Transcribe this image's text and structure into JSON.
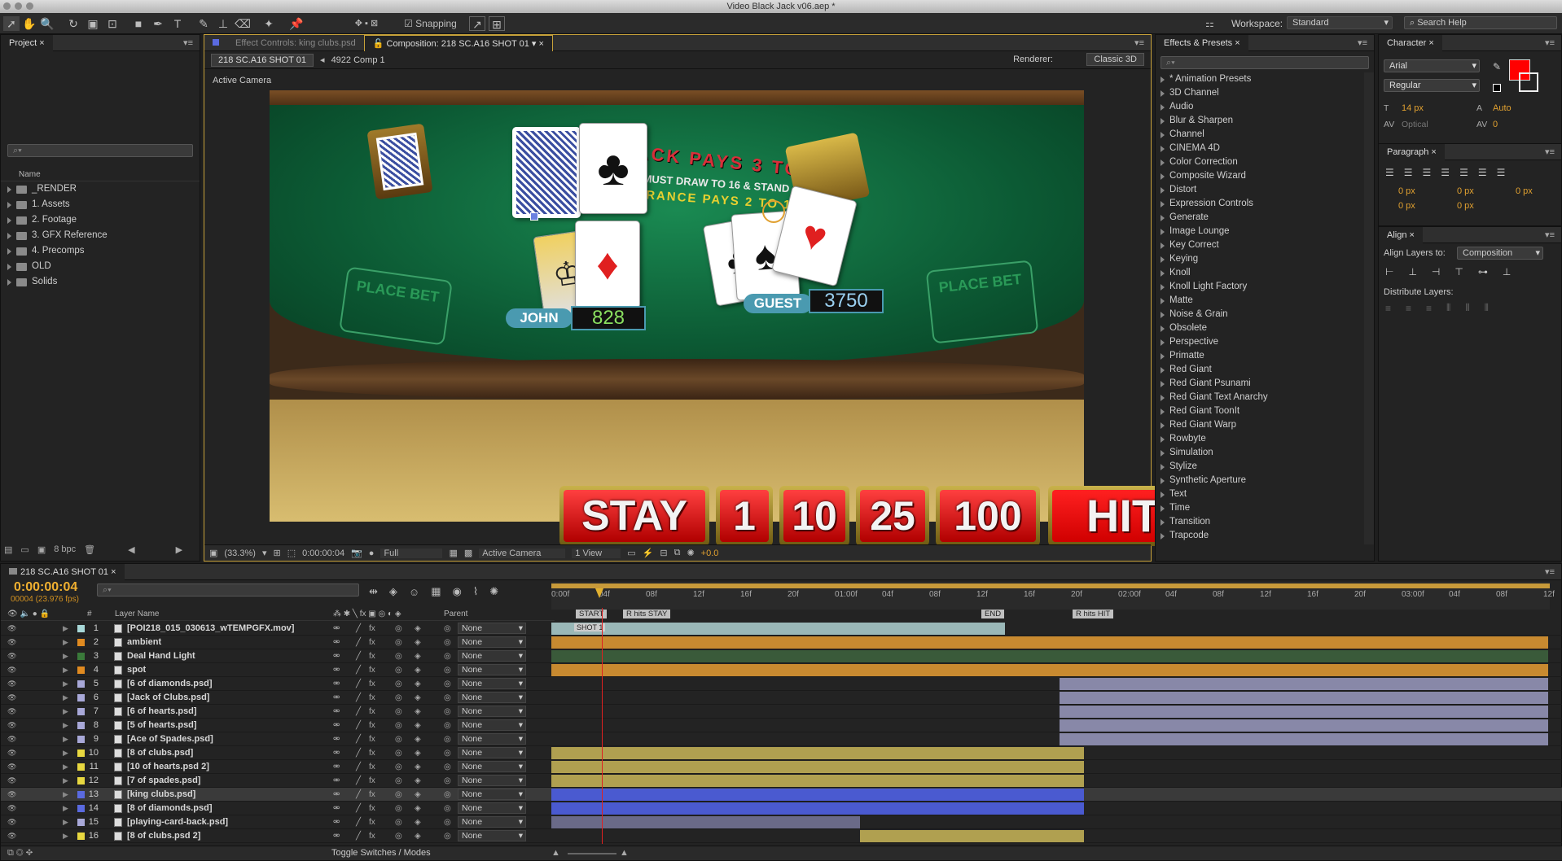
{
  "window": {
    "title": "Video Black Jack v06.aep *"
  },
  "toolbar": {
    "snapping": "Snapping",
    "workspace_label": "Workspace:",
    "workspace": "Standard",
    "search_help": "Search Help"
  },
  "project": {
    "tab": "Project",
    "col_name": "Name",
    "bpc": "8 bpc",
    "items": [
      "_RENDER",
      "1. Assets",
      "2. Footage",
      "3. GFX Reference",
      "4. Precomps",
      "OLD",
      "Solids"
    ]
  },
  "comp_panel": {
    "tab_effect": "Effect Controls: king clubs.psd",
    "tab_comp": "Composition: 218 SC.A16 SHOT 01",
    "crumb1": "218 SC.A16 SHOT 01",
    "crumb2": "4922 Comp 1",
    "renderer_label": "Renderer:",
    "renderer": "Classic 3D",
    "camera": "Active Camera",
    "footer": {
      "zoom": "(33.3%)",
      "time": "0:00:00:04",
      "res": "Full",
      "view_cam": "Active Camera",
      "views": "1 View",
      "exposure": "+0.0"
    }
  },
  "game": {
    "title_text": "BLACKJACK PAYS 3 TO 2",
    "sub_text": "DEALER MUST DRAW TO 16 & STAND",
    "ins_text": "INSURANCE PAYS 2 TO 1",
    "place_bet": "PLACE BET",
    "player1": "JOHN",
    "score1": "828",
    "player2": "GUEST",
    "score2": "3750",
    "buttons": [
      "STAY",
      "1",
      "10",
      "25",
      "100",
      "HIT"
    ]
  },
  "effects": {
    "tab": "Effects & Presets",
    "items": [
      "* Animation Presets",
      "3D Channel",
      "Audio",
      "Blur & Sharpen",
      "Channel",
      "CINEMA 4D",
      "Color Correction",
      "Composite Wizard",
      "Distort",
      "Expression Controls",
      "Generate",
      "Image Lounge",
      "Key Correct",
      "Keying",
      "Knoll",
      "Knoll Light Factory",
      "Matte",
      "Noise & Grain",
      "Obsolete",
      "Perspective",
      "Primatte",
      "Red Giant",
      "Red Giant Psunami",
      "Red Giant Text Anarchy",
      "Red Giant ToonIt",
      "Red Giant Warp",
      "Rowbyte",
      "Simulation",
      "Stylize",
      "Synthetic Aperture",
      "Text",
      "Time",
      "Transition",
      "Trapcode"
    ]
  },
  "character": {
    "tab": "Character",
    "font": "Arial",
    "style": "Regular",
    "size": "14 px",
    "leading": "Auto",
    "kerning": "Optical",
    "tracking": "0",
    "color": "#ff0000"
  },
  "paragraph": {
    "tab": "Paragraph",
    "v1": "0 px",
    "v2": "0 px",
    "v3": "0 px",
    "v4": "0 px",
    "v5": "0 px"
  },
  "align": {
    "tab": "Align",
    "align_to_label": "Align Layers to:",
    "align_to": "Composition",
    "distribute": "Distribute Layers:"
  },
  "timeline": {
    "tab": "218 SC.A16 SHOT 01",
    "time": "0:00:00:04",
    "frames": "00004 (23.976 fps)",
    "col_layer": "Layer Name",
    "col_parent": "Parent",
    "toggle": "Toggle Switches / Modes",
    "ruler": [
      "0:00f",
      "04f",
      "08f",
      "12f",
      "16f",
      "20f",
      "01:00f",
      "04f",
      "08f",
      "12f",
      "16f",
      "20f",
      "02:00f",
      "04f",
      "08f",
      "12f",
      "16f",
      "20f",
      "03:00f",
      "04f",
      "08f",
      "12f"
    ],
    "markers": [
      "START",
      "R hits STAY",
      "END",
      "R hits HIT"
    ],
    "shot_marker": "SHOT 1",
    "layers": [
      {
        "n": "1",
        "name": "[POI218_015_030613_wTEMPGFX.mov]",
        "color": "#a8d8d8",
        "parent": "None"
      },
      {
        "n": "2",
        "name": "ambient",
        "color": "#e08a20",
        "parent": "None"
      },
      {
        "n": "3",
        "name": "Deal Hand Light",
        "color": "#3a7a3a",
        "parent": "None"
      },
      {
        "n": "4",
        "name": "spot",
        "color": "#e08a20",
        "parent": "None"
      },
      {
        "n": "5",
        "name": "[6 of diamonds.psd]",
        "color": "#a8a8d8",
        "parent": "None"
      },
      {
        "n": "6",
        "name": "[Jack of Clubs.psd]",
        "color": "#a8a8d8",
        "parent": "None"
      },
      {
        "n": "7",
        "name": "[6 of hearts.psd]",
        "color": "#a8a8d8",
        "parent": "None"
      },
      {
        "n": "8",
        "name": "[5 of hearts.psd]",
        "color": "#a8a8d8",
        "parent": "None"
      },
      {
        "n": "9",
        "name": "[Ace of Spades.psd]",
        "color": "#a8a8d8",
        "parent": "None"
      },
      {
        "n": "10",
        "name": "[8 of clubs.psd]",
        "color": "#e8d840",
        "parent": "None"
      },
      {
        "n": "11",
        "name": "[10 of hearts.psd 2]",
        "color": "#e8d840",
        "parent": "None"
      },
      {
        "n": "12",
        "name": "[7 of spades.psd]",
        "color": "#e8d840",
        "parent": "None"
      },
      {
        "n": "13",
        "name": "[king clubs.psd]",
        "color": "#5a6ae0",
        "parent": "None"
      },
      {
        "n": "14",
        "name": "[8 of diamonds.psd]",
        "color": "#5a6ae0",
        "parent": "None"
      },
      {
        "n": "15",
        "name": "[playing-card-back.psd]",
        "color": "#a8a8d8",
        "parent": "None"
      },
      {
        "n": "16",
        "name": "[8 of clubs.psd 2]",
        "color": "#e8d840",
        "parent": "None"
      }
    ]
  }
}
